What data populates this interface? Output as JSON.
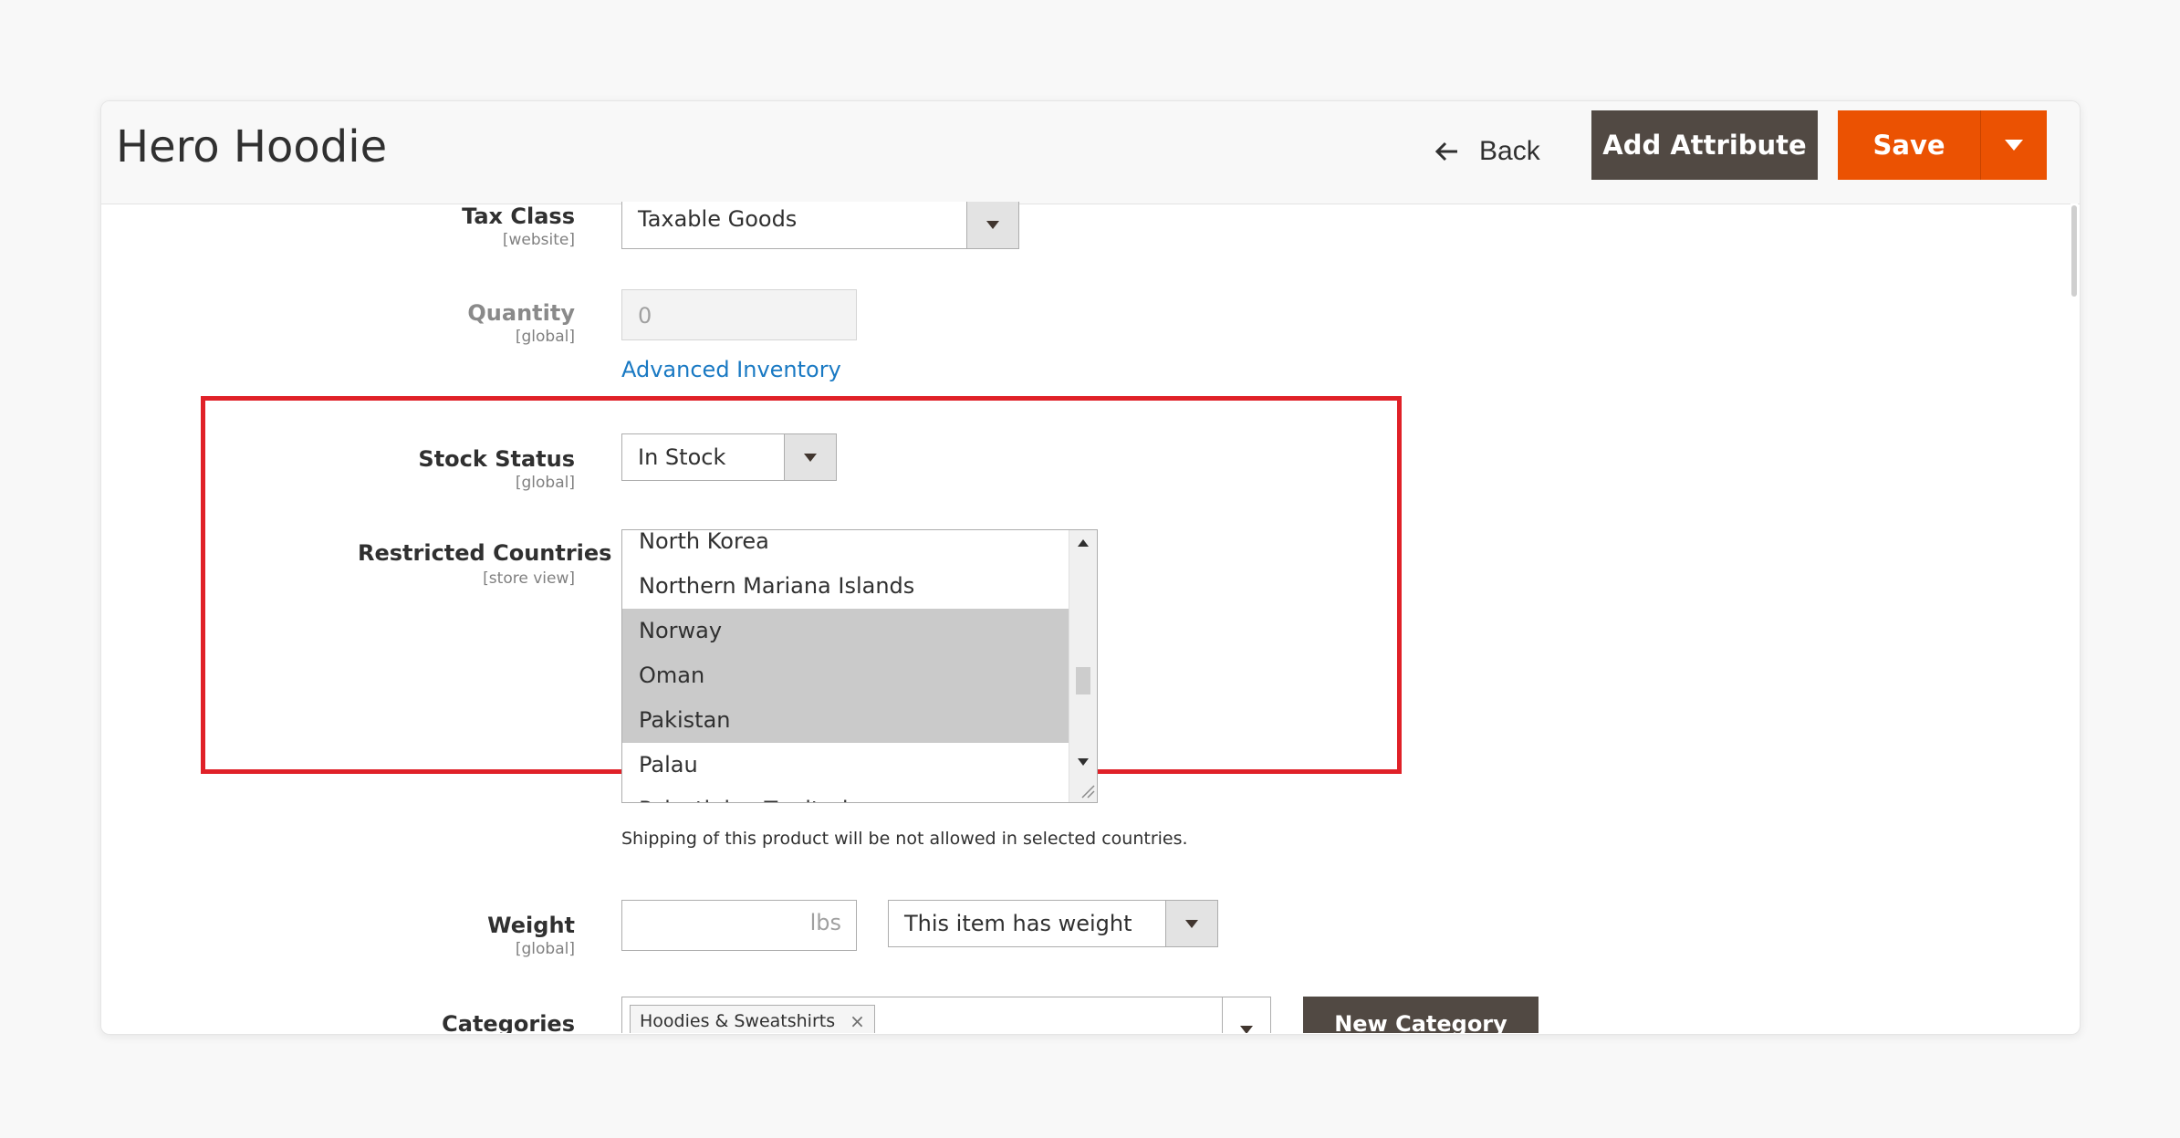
{
  "header": {
    "title": "Hero Hoodie",
    "back_label": "Back",
    "add_attribute_label": "Add Attribute",
    "save_label": "Save"
  },
  "fields": {
    "tax_class": {
      "label": "Tax Class",
      "scope": "[website]",
      "value": "Taxable Goods"
    },
    "quantity": {
      "label": "Quantity",
      "scope": "[global]",
      "value": "0",
      "link": "Advanced Inventory"
    },
    "stock_status": {
      "label": "Stock Status",
      "scope": "[global]",
      "value": "In Stock"
    },
    "restricted_countries": {
      "label": "Restricted Countries",
      "scope": "[store view]",
      "options": [
        {
          "name": "North Korea",
          "selected": false
        },
        {
          "name": "Northern Mariana Islands",
          "selected": false
        },
        {
          "name": "Norway",
          "selected": true
        },
        {
          "name": "Oman",
          "selected": true
        },
        {
          "name": "Pakistan",
          "selected": true
        },
        {
          "name": "Palau",
          "selected": false
        },
        {
          "name": "Palestinian Territories",
          "selected": false
        }
      ],
      "note": "Shipping of this product will be not allowed in selected countries."
    },
    "weight": {
      "label": "Weight",
      "scope": "[global]",
      "unit": "lbs",
      "value": "",
      "has_weight": "This item has weight"
    },
    "categories": {
      "label": "Categories",
      "tag": "Hoodies & Sweatshirts",
      "tag_remove": "×",
      "new_category_label": "New Category"
    }
  },
  "colors": {
    "accent": "#eb5202",
    "dark_button": "#514943",
    "highlight": "#e02128",
    "link": "#1979c3"
  }
}
